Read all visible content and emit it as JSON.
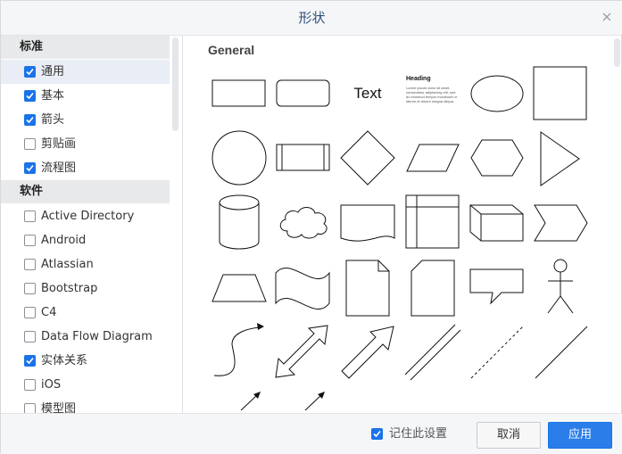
{
  "dialog": {
    "title": "形状"
  },
  "sidebar": {
    "sections": [
      {
        "header": "标准",
        "items": [
          {
            "label": "通用",
            "checked": true,
            "selected": true
          },
          {
            "label": "基本",
            "checked": true
          },
          {
            "label": "箭头",
            "checked": true
          },
          {
            "label": "剪贴画",
            "checked": false
          },
          {
            "label": "流程图",
            "checked": true
          }
        ]
      },
      {
        "header": "软件",
        "items": [
          {
            "label": "Active Directory",
            "checked": false
          },
          {
            "label": "Android",
            "checked": false
          },
          {
            "label": "Atlassian",
            "checked": false
          },
          {
            "label": "Bootstrap",
            "checked": false
          },
          {
            "label": "C4",
            "checked": false
          },
          {
            "label": "Data Flow Diagram",
            "checked": false
          },
          {
            "label": "实体关系",
            "checked": true
          },
          {
            "label": "iOS",
            "checked": false
          },
          {
            "label": "模型图",
            "checked": false
          }
        ]
      }
    ]
  },
  "main": {
    "group_title": "General",
    "text_shape_label": "Text",
    "heading_shape": {
      "heading": "Heading",
      "body": "Lorem ipsum dolor sit amet, consectetur adipisicing elit, sed do eiusmod tempor incididunt ut labore et dolore magna aliqua."
    }
  },
  "footer": {
    "remember_label": "记住此设置",
    "remember_checked": true,
    "cancel_label": "取消",
    "apply_label": "应用"
  },
  "colors": {
    "accent": "#2b7de9",
    "title_text": "#2f4f7a"
  }
}
